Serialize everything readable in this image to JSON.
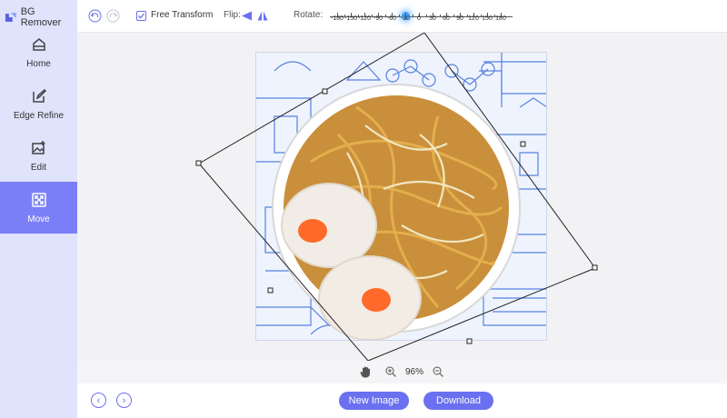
{
  "app": {
    "title": "BG Remover"
  },
  "sidebar": {
    "items": [
      {
        "label": "Home",
        "icon": "home-icon",
        "active": false
      },
      {
        "label": "Edge Refine",
        "icon": "edge-refine-icon",
        "active": false
      },
      {
        "label": "Edit",
        "icon": "image-edit-icon",
        "active": false
      },
      {
        "label": "Move",
        "icon": "move-arrows-icon",
        "active": true
      }
    ]
  },
  "toolbar": {
    "free_transform_label": "Free Transform",
    "free_transform_checked": true,
    "flip_label": "Flip:",
    "rotate_label": "Rotate:",
    "rotate_ticks": [
      "-180",
      "-150",
      "-120",
      "-90",
      "-60",
      "-30",
      "0",
      "30",
      "60",
      "90",
      "120",
      "150",
      "180"
    ],
    "rotate_value": -30
  },
  "zoom": {
    "value": "96%"
  },
  "bottom": {
    "new_image_label": "New Image",
    "download_label": "Download"
  },
  "colors": {
    "accent": "#6b70f0",
    "active_nav": "#7b7ff7",
    "sidebar_bg": "#dfe3fb"
  }
}
